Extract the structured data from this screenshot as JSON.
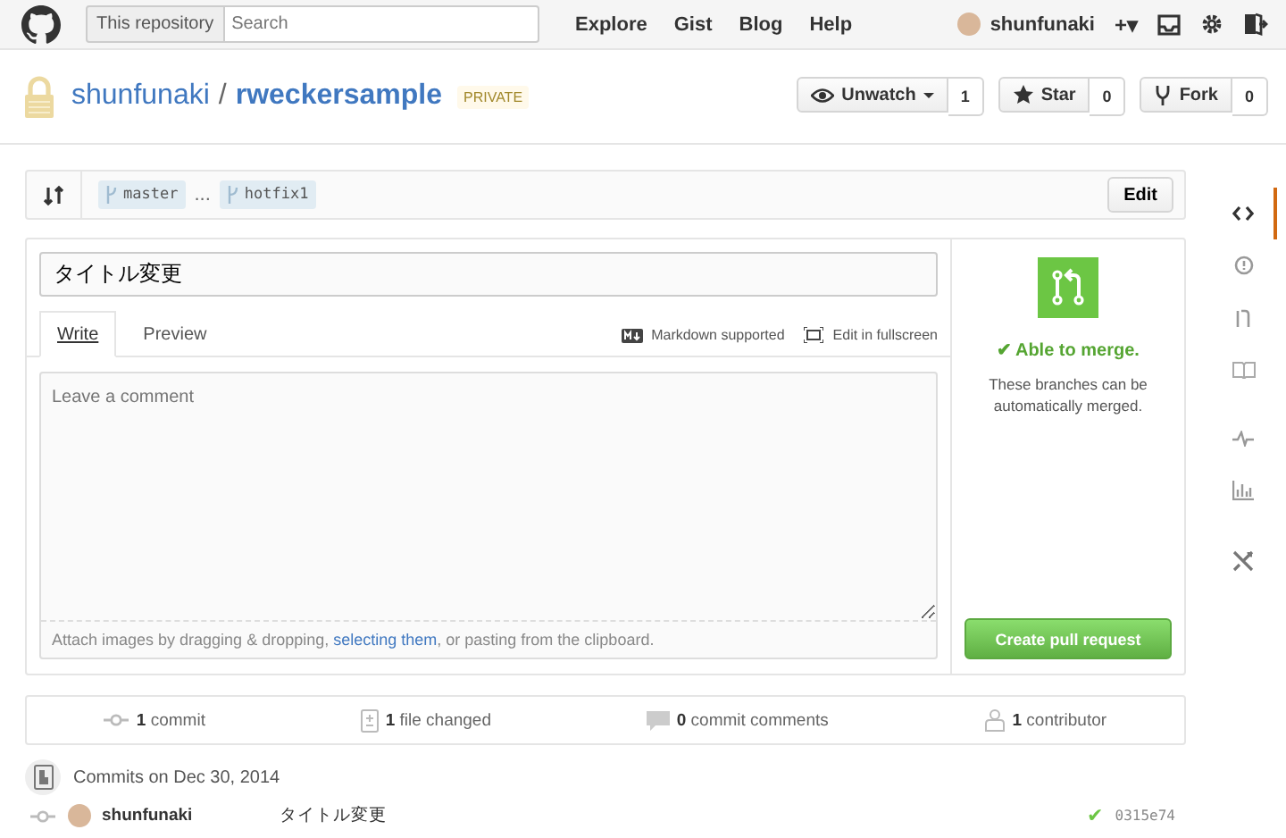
{
  "header": {
    "search_scope": "This repository",
    "search_placeholder": "Search",
    "nav": [
      "Explore",
      "Gist",
      "Blog",
      "Help"
    ],
    "username": "shunfunaki",
    "new_caret": "+▾"
  },
  "repo": {
    "owner": "shunfunaki",
    "separator": "/",
    "name": "rweckersample",
    "badge": "PRIVATE",
    "actions": [
      {
        "label": "Unwatch",
        "caret": true,
        "count": "1",
        "kind": "eye"
      },
      {
        "label": "Star",
        "caret": false,
        "count": "0",
        "kind": "star"
      },
      {
        "label": "Fork",
        "caret": false,
        "count": "0",
        "kind": "fork"
      }
    ]
  },
  "compare": {
    "base": "master",
    "ellipsis": "...",
    "head": "hotfix1",
    "edit": "Edit"
  },
  "form": {
    "title_value": "タイトル変更",
    "tabs": [
      {
        "label": "Write",
        "selected": true
      },
      {
        "label": "Preview",
        "selected": false
      }
    ],
    "markdown": "Markdown supported",
    "fullscreen": "Edit in fullscreen",
    "comment_placeholder": "Leave a comment",
    "attach_before": "Attach images by dragging & dropping, ",
    "attach_link": "selecting them",
    "attach_after": ", or pasting from the clipboard."
  },
  "merge": {
    "status": "✔ Able to merge.",
    "message": "These branches can be automatically merged.",
    "button": "Create pull request"
  },
  "stats": [
    {
      "kind": "commit",
      "text": "**1** commit"
    },
    {
      "kind": "file",
      "text": "**1** file changed"
    },
    {
      "kind": "comment",
      "text": "**0** commit comments"
    },
    {
      "kind": "people",
      "text": "**1** contributor"
    }
  ],
  "commits": {
    "heading": "Commits on Dec 30, 2014",
    "rows": [
      {
        "author": "shunfunaki",
        "message": "タイトル変更",
        "check": "✔",
        "sha": "0315e74"
      }
    ]
  },
  "sidebar": [
    {
      "kind": "code",
      "selected": true
    },
    {
      "kind": "issue",
      "selected": false
    },
    {
      "kind": "pr",
      "selected": false
    },
    {
      "kind": "wiki",
      "selected": false
    },
    {
      "kind": "pulse",
      "selected": false
    },
    {
      "kind": "graph",
      "selected": false
    },
    {
      "kind": "tools",
      "selected": false
    }
  ]
}
